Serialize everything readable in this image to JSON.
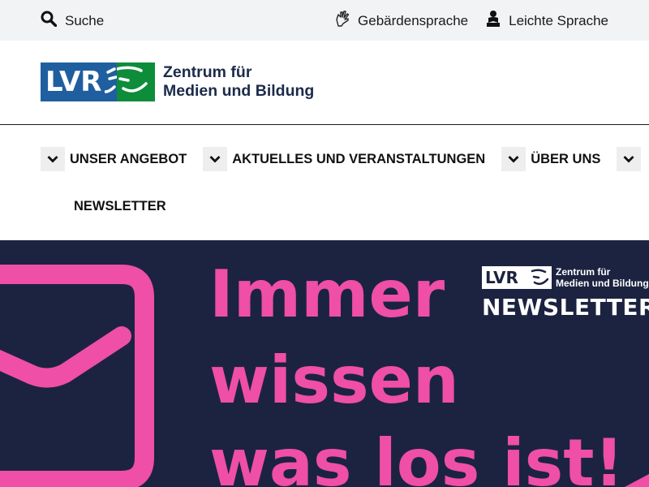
{
  "topbar": {
    "search_label": "Suche",
    "links": [
      {
        "label": "Gebärdensprache",
        "icon": "sign-language-icon"
      },
      {
        "label": "Leichte Sprache",
        "icon": "easy-reading-icon"
      }
    ]
  },
  "header": {
    "logo_text": "LVR",
    "title_line1": "Zentrum für",
    "title_line2": "Medien und Bildung"
  },
  "nav": {
    "items": [
      {
        "label": "UNSER ANGEBOT"
      },
      {
        "label": "AKTUELLES UND VERANSTALTUNGEN"
      },
      {
        "label": "ÜBER UNS"
      },
      {
        "label": "NEWSLETTER"
      }
    ]
  },
  "hero": {
    "line1": "Immer",
    "line2": "wissen",
    "line3": "was los ist!",
    "badge_logo_text": "LVR",
    "badge_title_line1": "Zentrum für",
    "badge_title_line2": "Medien und Bildung",
    "badge_heading": "NEWSLETTER"
  },
  "colors": {
    "topbar_bg": "#f2f3f4",
    "lvr_blue": "#1f5fa0",
    "lvr_green": "#0d8d3a",
    "hero_bg": "#1c2340",
    "hero_pink": "#ef4fa6"
  }
}
